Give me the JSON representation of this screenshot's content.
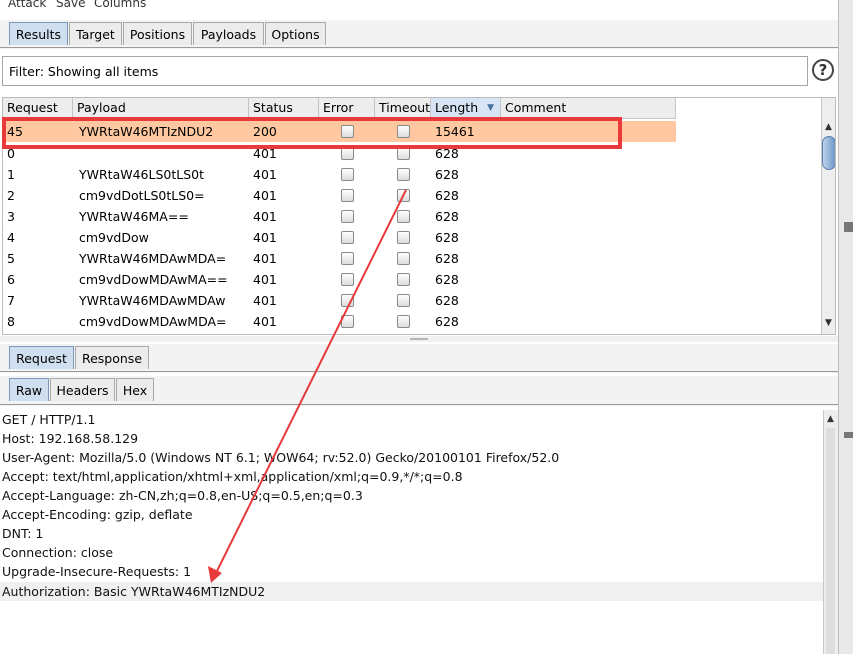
{
  "menu": [
    "Attack",
    "Save",
    "Columns"
  ],
  "main_tabs": [
    "Results",
    "Target",
    "Positions",
    "Payloads",
    "Options"
  ],
  "filter": {
    "text": "Filter: Showing all items",
    "help_icon": "?"
  },
  "table": {
    "columns": [
      "Request",
      "Payload",
      "Status",
      "Error",
      "Timeout",
      "Length",
      "Comment"
    ],
    "sort_icon": "▼",
    "rows": [
      {
        "request": "45",
        "payload": "YWRtaW46MTIzNDU2",
        "status": "200",
        "length": "15461"
      },
      {
        "request": "0",
        "payload": "",
        "status": "401",
        "length": "628"
      },
      {
        "request": "1",
        "payload": "YWRtaW46LS0tLS0t",
        "status": "401",
        "length": "628"
      },
      {
        "request": "2",
        "payload": "cm9vdDotLS0tLS0=",
        "status": "401",
        "length": "628"
      },
      {
        "request": "3",
        "payload": "YWRtaW46MA==",
        "status": "401",
        "length": "628"
      },
      {
        "request": "4",
        "payload": "cm9vdDow",
        "status": "401",
        "length": "628"
      },
      {
        "request": "5",
        "payload": "YWRtaW46MDAwMDA=",
        "status": "401",
        "length": "628"
      },
      {
        "request": "6",
        "payload": "cm9vdDowMDAwMA==",
        "status": "401",
        "length": "628"
      },
      {
        "request": "7",
        "payload": "YWRtaW46MDAwMDAw",
        "status": "401",
        "length": "628"
      },
      {
        "request": "8",
        "payload": "cm9vdDowMDAwMDA=",
        "status": "401",
        "length": "628"
      }
    ]
  },
  "detail_tabs": [
    "Request",
    "Response"
  ],
  "view_tabs": [
    "Raw",
    "Headers",
    "Hex"
  ],
  "request_lines": [
    "GET / HTTP/1.1",
    "Host: 192.168.58.129",
    "User-Agent: Mozilla/5.0 (Windows NT 6.1; WOW64; rv:52.0) Gecko/20100101 Firefox/52.0",
    "Accept: text/html,application/xhtml+xml,application/xml;q=0.9,*/*;q=0.8",
    "Accept-Language: zh-CN,zh;q=0.8,en-US;q=0.5,en;q=0.3",
    "Accept-Encoding: gzip, deflate",
    "DNT: 1",
    "Connection: close",
    "Upgrade-Insecure-Requests: 1",
    "Authorization: Basic YWRtaW46MTIzNDU2"
  ],
  "colors": {
    "highlight_row": "#ffc8a0",
    "annotation_red": "#e8393b",
    "active_tab": "#cfdff0"
  }
}
